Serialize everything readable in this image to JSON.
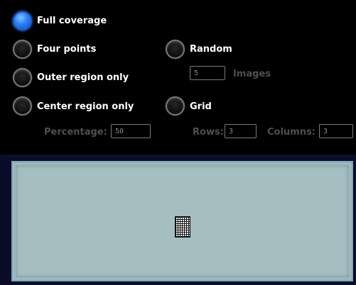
{
  "options": {
    "full_coverage": "Full coverage",
    "four_points": "Four points",
    "outer_region_only": "Outer region only",
    "center_region_only": "Center region only",
    "random": "Random",
    "grid": "Grid"
  },
  "selected_option": "Full coverage",
  "random": {
    "images_value": "5",
    "images_label": "Images"
  },
  "center": {
    "percentage_label": "Percentage:",
    "percentage_value": "50"
  },
  "grid": {
    "rows_label": "Rows:",
    "rows_value": "3",
    "columns_label": "Columns:",
    "columns_value": "3"
  },
  "colors": {
    "selected_radio": "#2f7ff2",
    "panel_background": "#000000",
    "preview_background": "#a4bec2",
    "disabled_text": "#4f4f4f"
  },
  "icons": {
    "preview": "grid-pattern-icon"
  }
}
